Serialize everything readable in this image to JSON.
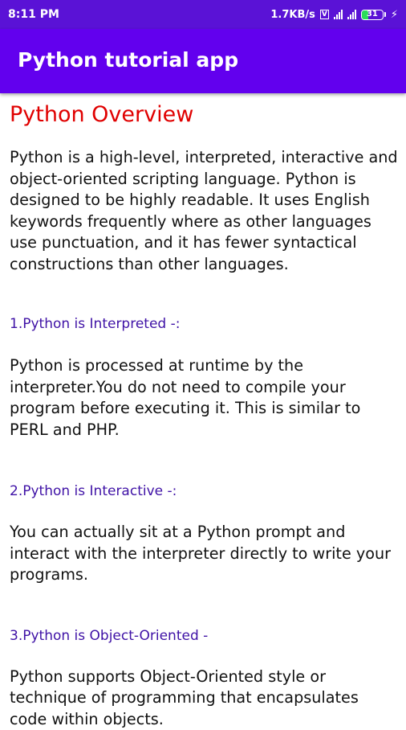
{
  "status_bar": {
    "time": "8:11 PM",
    "network_speed": "1.7KB/s",
    "battery_level": "31",
    "icons": [
      "volte-icon",
      "signal-4g-icon",
      "signal-icon",
      "battery-icon",
      "charging-bolt-icon"
    ]
  },
  "app_bar": {
    "title": "Python tutorial app",
    "background_color": "#6200ee"
  },
  "content": {
    "title": "Python Overview",
    "title_color": "#e00000",
    "intro": "Python is a high-level, interpreted, interactive and object-oriented scripting language. Python is designed to be highly readable. It uses English keywords frequently where as other languages use punctuation, and it has fewer syntactical constructions than other languages.",
    "sections": [
      {
        "heading": "1.Python is Interpreted -:",
        "body": "Python is processed at runtime by the interpreter.You do not need to compile your program before executing it. This is similar to PERL and PHP."
      },
      {
        "heading": "2.Python is Interactive -:",
        "body": "You can actually sit at a Python prompt and interact with the interpreter directly to write your programs."
      },
      {
        "heading": "3.Python is Object-Oriented -",
        "body": "Python supports Object-Oriented style or technique of programming that encapsulates code within objects."
      }
    ],
    "heading_color": "#3f12a6"
  }
}
